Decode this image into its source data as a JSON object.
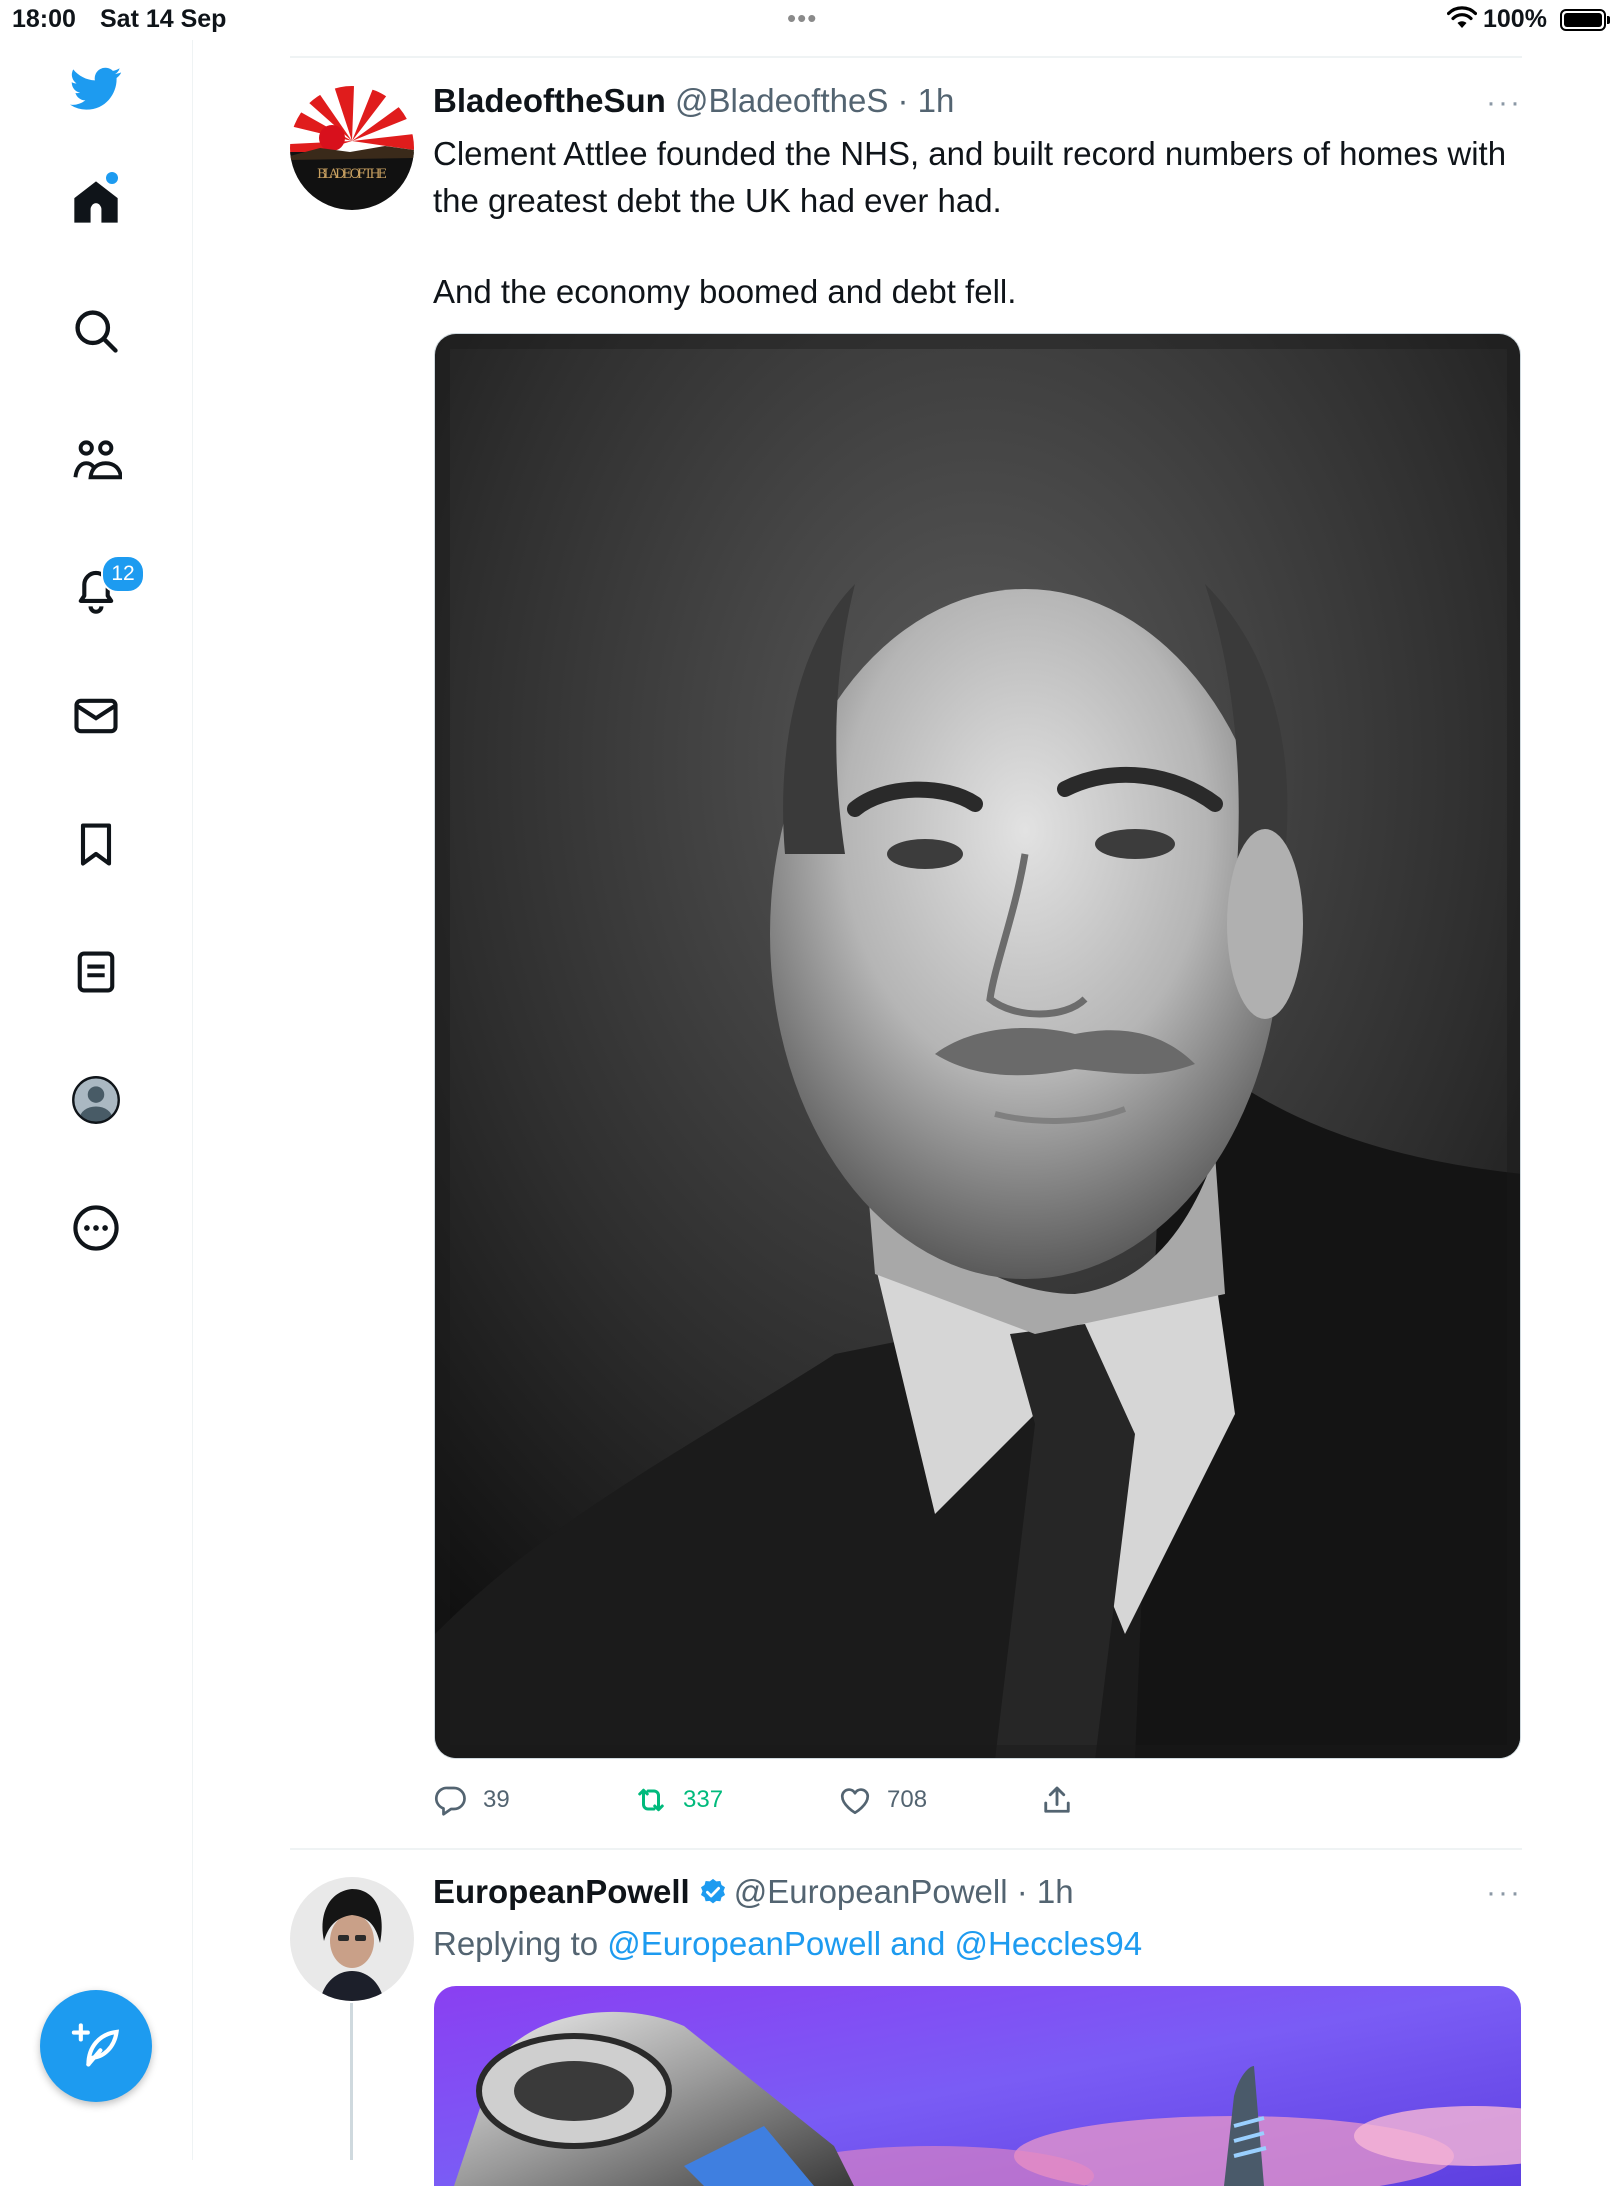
{
  "status_bar": {
    "time": "18:00",
    "date": "Sat 14 Sep",
    "battery": "100%"
  },
  "nav": {
    "items": [
      {
        "icon": "twitter-logo-icon"
      },
      {
        "icon": "home-icon"
      },
      {
        "icon": "search-icon"
      },
      {
        "icon": "communities-icon"
      },
      {
        "icon": "notifications-bell-icon",
        "badge": "12"
      },
      {
        "icon": "messages-envelope-icon"
      },
      {
        "icon": "bookmark-icon"
      },
      {
        "icon": "lists-icon"
      },
      {
        "icon": "profile-avatar-icon"
      },
      {
        "icon": "more-options-icon"
      }
    ],
    "notifications_badge": "12",
    "compose_icon": "compose-tweet-icon"
  },
  "tweets": [
    {
      "name": "BladeoftheSun",
      "handle": "@BladeoftheS",
      "time": "· 1h",
      "more": "···",
      "avatar_text": "BLADE OF THE",
      "text_p1": "Clement Attlee founded the NHS, and built record numbers of homes with the greatest debt the UK had ever had.",
      "text_p2": "And the economy boomed and debt fell.",
      "media": "black-and-white portrait photo",
      "replies": "39",
      "retweets": "337",
      "likes": "708"
    },
    {
      "name": "EuropeanPowell",
      "handle": "@EuropeanPowell",
      "time": "· 1h",
      "more": "···",
      "verified": true,
      "replying_prefix": "Replying to",
      "replying_to": "@EuropeanPowell and @Heccles94",
      "media": "illustration"
    }
  ],
  "colors": {
    "accent": "#1d9bf0",
    "retweet": "#00ba7c",
    "secondary_text": "#536471",
    "divider": "#eff3f4"
  }
}
